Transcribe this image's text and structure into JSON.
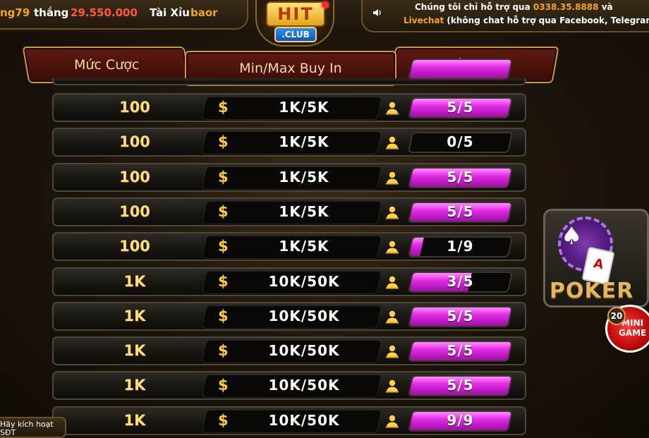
{
  "ticker": {
    "user_fragment": "ng79",
    "verb": "thắng",
    "amount": "29.550.000",
    "game": "Tài Xỉu",
    "user2_fragment": "baor"
  },
  "support": {
    "line1_prefix": "Chúng tôi chỉ hỗ trợ qua",
    "phone": "0338.35.8888",
    "line1_suffix": "và",
    "livechat": "Livechat",
    "line2": "(không chat hỗ trợ qua Facebook, Telegram...)"
  },
  "logo": {
    "top": "HIT",
    "bottom": ".CLUB"
  },
  "headers": {
    "stake": "Mức Cược",
    "buyin": "Min/Max Buy In",
    "players": "Số Người"
  },
  "rows": [
    {
      "stake": "100",
      "buyin": "1K/5K",
      "players": "5/5",
      "fill": 1.0
    },
    {
      "stake": "100",
      "buyin": "1K/5K",
      "players": "0/5",
      "fill": 0.0
    },
    {
      "stake": "100",
      "buyin": "1K/5K",
      "players": "5/5",
      "fill": 1.0
    },
    {
      "stake": "100",
      "buyin": "1K/5K",
      "players": "5/5",
      "fill": 1.0
    },
    {
      "stake": "100",
      "buyin": "1K/5K",
      "players": "1/9",
      "fill": 0.111
    },
    {
      "stake": "1K",
      "buyin": "10K/50K",
      "players": "3/5",
      "fill": 0.6
    },
    {
      "stake": "1K",
      "buyin": "10K/50K",
      "players": "5/5",
      "fill": 1.0
    },
    {
      "stake": "1K",
      "buyin": "10K/50K",
      "players": "5/5",
      "fill": 1.0
    },
    {
      "stake": "1K",
      "buyin": "10K/50K",
      "players": "5/5",
      "fill": 1.0
    },
    {
      "stake": "1K",
      "buyin": "10K/50K",
      "players": "9/9",
      "fill": 1.0
    }
  ],
  "icons": {
    "currency": "$",
    "player": "player-icon",
    "sound": "speaker-icon"
  },
  "poker_widget": {
    "label": "POKER",
    "card": "A"
  },
  "mini_game": {
    "badge": "20",
    "label_line1": "MINI",
    "label_line2": "GAME"
  },
  "activate": {
    "line1": "Hãy kích hoạt",
    "line2": "SĐT"
  },
  "colors": {
    "accent_gold": "#ffde7a",
    "fill_magenta": "#e22be6",
    "header_red": "#5e1a11"
  }
}
